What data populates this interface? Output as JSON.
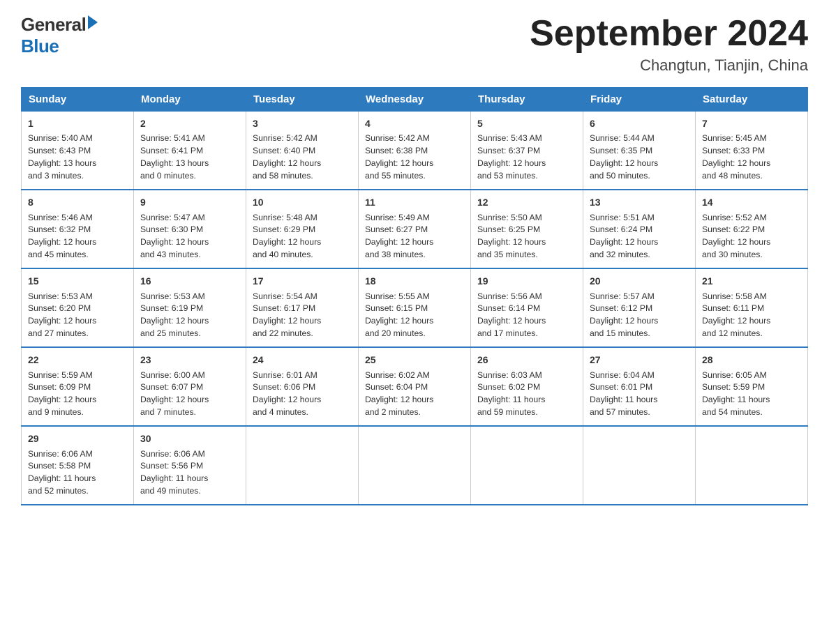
{
  "logo": {
    "text_general": "General",
    "text_blue": "Blue",
    "arrow": "▶"
  },
  "title": "September 2024",
  "subtitle": "Changtun, Tianjin, China",
  "days_of_week": [
    "Sunday",
    "Monday",
    "Tuesday",
    "Wednesday",
    "Thursday",
    "Friday",
    "Saturday"
  ],
  "weeks": [
    [
      {
        "day": "1",
        "info": "Sunrise: 5:40 AM\nSunset: 6:43 PM\nDaylight: 13 hours\nand 3 minutes."
      },
      {
        "day": "2",
        "info": "Sunrise: 5:41 AM\nSunset: 6:41 PM\nDaylight: 13 hours\nand 0 minutes."
      },
      {
        "day": "3",
        "info": "Sunrise: 5:42 AM\nSunset: 6:40 PM\nDaylight: 12 hours\nand 58 minutes."
      },
      {
        "day": "4",
        "info": "Sunrise: 5:42 AM\nSunset: 6:38 PM\nDaylight: 12 hours\nand 55 minutes."
      },
      {
        "day": "5",
        "info": "Sunrise: 5:43 AM\nSunset: 6:37 PM\nDaylight: 12 hours\nand 53 minutes."
      },
      {
        "day": "6",
        "info": "Sunrise: 5:44 AM\nSunset: 6:35 PM\nDaylight: 12 hours\nand 50 minutes."
      },
      {
        "day": "7",
        "info": "Sunrise: 5:45 AM\nSunset: 6:33 PM\nDaylight: 12 hours\nand 48 minutes."
      }
    ],
    [
      {
        "day": "8",
        "info": "Sunrise: 5:46 AM\nSunset: 6:32 PM\nDaylight: 12 hours\nand 45 minutes."
      },
      {
        "day": "9",
        "info": "Sunrise: 5:47 AM\nSunset: 6:30 PM\nDaylight: 12 hours\nand 43 minutes."
      },
      {
        "day": "10",
        "info": "Sunrise: 5:48 AM\nSunset: 6:29 PM\nDaylight: 12 hours\nand 40 minutes."
      },
      {
        "day": "11",
        "info": "Sunrise: 5:49 AM\nSunset: 6:27 PM\nDaylight: 12 hours\nand 38 minutes."
      },
      {
        "day": "12",
        "info": "Sunrise: 5:50 AM\nSunset: 6:25 PM\nDaylight: 12 hours\nand 35 minutes."
      },
      {
        "day": "13",
        "info": "Sunrise: 5:51 AM\nSunset: 6:24 PM\nDaylight: 12 hours\nand 32 minutes."
      },
      {
        "day": "14",
        "info": "Sunrise: 5:52 AM\nSunset: 6:22 PM\nDaylight: 12 hours\nand 30 minutes."
      }
    ],
    [
      {
        "day": "15",
        "info": "Sunrise: 5:53 AM\nSunset: 6:20 PM\nDaylight: 12 hours\nand 27 minutes."
      },
      {
        "day": "16",
        "info": "Sunrise: 5:53 AM\nSunset: 6:19 PM\nDaylight: 12 hours\nand 25 minutes."
      },
      {
        "day": "17",
        "info": "Sunrise: 5:54 AM\nSunset: 6:17 PM\nDaylight: 12 hours\nand 22 minutes."
      },
      {
        "day": "18",
        "info": "Sunrise: 5:55 AM\nSunset: 6:15 PM\nDaylight: 12 hours\nand 20 minutes."
      },
      {
        "day": "19",
        "info": "Sunrise: 5:56 AM\nSunset: 6:14 PM\nDaylight: 12 hours\nand 17 minutes."
      },
      {
        "day": "20",
        "info": "Sunrise: 5:57 AM\nSunset: 6:12 PM\nDaylight: 12 hours\nand 15 minutes."
      },
      {
        "day": "21",
        "info": "Sunrise: 5:58 AM\nSunset: 6:11 PM\nDaylight: 12 hours\nand 12 minutes."
      }
    ],
    [
      {
        "day": "22",
        "info": "Sunrise: 5:59 AM\nSunset: 6:09 PM\nDaylight: 12 hours\nand 9 minutes."
      },
      {
        "day": "23",
        "info": "Sunrise: 6:00 AM\nSunset: 6:07 PM\nDaylight: 12 hours\nand 7 minutes."
      },
      {
        "day": "24",
        "info": "Sunrise: 6:01 AM\nSunset: 6:06 PM\nDaylight: 12 hours\nand 4 minutes."
      },
      {
        "day": "25",
        "info": "Sunrise: 6:02 AM\nSunset: 6:04 PM\nDaylight: 12 hours\nand 2 minutes."
      },
      {
        "day": "26",
        "info": "Sunrise: 6:03 AM\nSunset: 6:02 PM\nDaylight: 11 hours\nand 59 minutes."
      },
      {
        "day": "27",
        "info": "Sunrise: 6:04 AM\nSunset: 6:01 PM\nDaylight: 11 hours\nand 57 minutes."
      },
      {
        "day": "28",
        "info": "Sunrise: 6:05 AM\nSunset: 5:59 PM\nDaylight: 11 hours\nand 54 minutes."
      }
    ],
    [
      {
        "day": "29",
        "info": "Sunrise: 6:06 AM\nSunset: 5:58 PM\nDaylight: 11 hours\nand 52 minutes."
      },
      {
        "day": "30",
        "info": "Sunrise: 6:06 AM\nSunset: 5:56 PM\nDaylight: 11 hours\nand 49 minutes."
      },
      {
        "day": "",
        "info": ""
      },
      {
        "day": "",
        "info": ""
      },
      {
        "day": "",
        "info": ""
      },
      {
        "day": "",
        "info": ""
      },
      {
        "day": "",
        "info": ""
      }
    ]
  ]
}
